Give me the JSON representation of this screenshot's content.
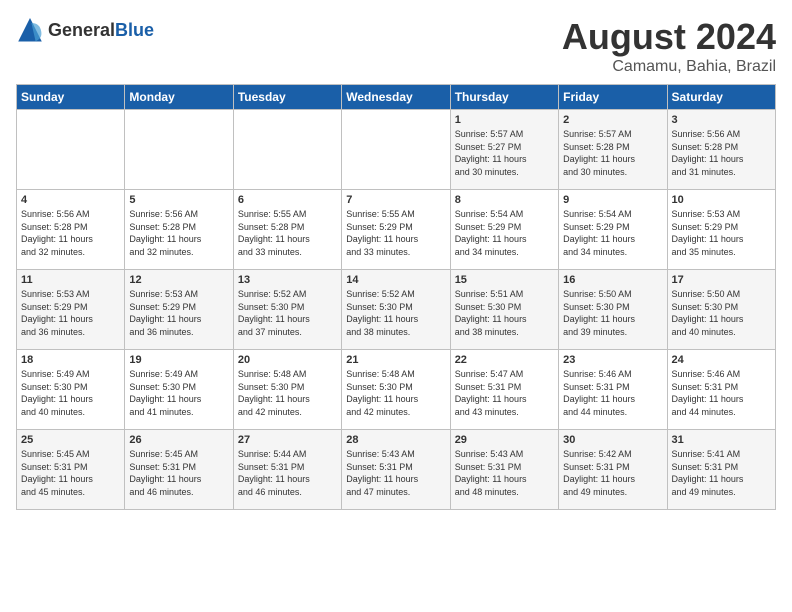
{
  "logo": {
    "general": "General",
    "blue": "Blue"
  },
  "title": "August 2024",
  "subtitle": "Camamu, Bahia, Brazil",
  "headers": [
    "Sunday",
    "Monday",
    "Tuesday",
    "Wednesday",
    "Thursday",
    "Friday",
    "Saturday"
  ],
  "weeks": [
    [
      {
        "day": "",
        "info": ""
      },
      {
        "day": "",
        "info": ""
      },
      {
        "day": "",
        "info": ""
      },
      {
        "day": "",
        "info": ""
      },
      {
        "day": "1",
        "info": "Sunrise: 5:57 AM\nSunset: 5:27 PM\nDaylight: 11 hours\nand 30 minutes."
      },
      {
        "day": "2",
        "info": "Sunrise: 5:57 AM\nSunset: 5:28 PM\nDaylight: 11 hours\nand 30 minutes."
      },
      {
        "day": "3",
        "info": "Sunrise: 5:56 AM\nSunset: 5:28 PM\nDaylight: 11 hours\nand 31 minutes."
      }
    ],
    [
      {
        "day": "4",
        "info": "Sunrise: 5:56 AM\nSunset: 5:28 PM\nDaylight: 11 hours\nand 32 minutes."
      },
      {
        "day": "5",
        "info": "Sunrise: 5:56 AM\nSunset: 5:28 PM\nDaylight: 11 hours\nand 32 minutes."
      },
      {
        "day": "6",
        "info": "Sunrise: 5:55 AM\nSunset: 5:28 PM\nDaylight: 11 hours\nand 33 minutes."
      },
      {
        "day": "7",
        "info": "Sunrise: 5:55 AM\nSunset: 5:29 PM\nDaylight: 11 hours\nand 33 minutes."
      },
      {
        "day": "8",
        "info": "Sunrise: 5:54 AM\nSunset: 5:29 PM\nDaylight: 11 hours\nand 34 minutes."
      },
      {
        "day": "9",
        "info": "Sunrise: 5:54 AM\nSunset: 5:29 PM\nDaylight: 11 hours\nand 34 minutes."
      },
      {
        "day": "10",
        "info": "Sunrise: 5:53 AM\nSunset: 5:29 PM\nDaylight: 11 hours\nand 35 minutes."
      }
    ],
    [
      {
        "day": "11",
        "info": "Sunrise: 5:53 AM\nSunset: 5:29 PM\nDaylight: 11 hours\nand 36 minutes."
      },
      {
        "day": "12",
        "info": "Sunrise: 5:53 AM\nSunset: 5:29 PM\nDaylight: 11 hours\nand 36 minutes."
      },
      {
        "day": "13",
        "info": "Sunrise: 5:52 AM\nSunset: 5:30 PM\nDaylight: 11 hours\nand 37 minutes."
      },
      {
        "day": "14",
        "info": "Sunrise: 5:52 AM\nSunset: 5:30 PM\nDaylight: 11 hours\nand 38 minutes."
      },
      {
        "day": "15",
        "info": "Sunrise: 5:51 AM\nSunset: 5:30 PM\nDaylight: 11 hours\nand 38 minutes."
      },
      {
        "day": "16",
        "info": "Sunrise: 5:50 AM\nSunset: 5:30 PM\nDaylight: 11 hours\nand 39 minutes."
      },
      {
        "day": "17",
        "info": "Sunrise: 5:50 AM\nSunset: 5:30 PM\nDaylight: 11 hours\nand 40 minutes."
      }
    ],
    [
      {
        "day": "18",
        "info": "Sunrise: 5:49 AM\nSunset: 5:30 PM\nDaylight: 11 hours\nand 40 minutes."
      },
      {
        "day": "19",
        "info": "Sunrise: 5:49 AM\nSunset: 5:30 PM\nDaylight: 11 hours\nand 41 minutes."
      },
      {
        "day": "20",
        "info": "Sunrise: 5:48 AM\nSunset: 5:30 PM\nDaylight: 11 hours\nand 42 minutes."
      },
      {
        "day": "21",
        "info": "Sunrise: 5:48 AM\nSunset: 5:30 PM\nDaylight: 11 hours\nand 42 minutes."
      },
      {
        "day": "22",
        "info": "Sunrise: 5:47 AM\nSunset: 5:31 PM\nDaylight: 11 hours\nand 43 minutes."
      },
      {
        "day": "23",
        "info": "Sunrise: 5:46 AM\nSunset: 5:31 PM\nDaylight: 11 hours\nand 44 minutes."
      },
      {
        "day": "24",
        "info": "Sunrise: 5:46 AM\nSunset: 5:31 PM\nDaylight: 11 hours\nand 44 minutes."
      }
    ],
    [
      {
        "day": "25",
        "info": "Sunrise: 5:45 AM\nSunset: 5:31 PM\nDaylight: 11 hours\nand 45 minutes."
      },
      {
        "day": "26",
        "info": "Sunrise: 5:45 AM\nSunset: 5:31 PM\nDaylight: 11 hours\nand 46 minutes."
      },
      {
        "day": "27",
        "info": "Sunrise: 5:44 AM\nSunset: 5:31 PM\nDaylight: 11 hours\nand 46 minutes."
      },
      {
        "day": "28",
        "info": "Sunrise: 5:43 AM\nSunset: 5:31 PM\nDaylight: 11 hours\nand 47 minutes."
      },
      {
        "day": "29",
        "info": "Sunrise: 5:43 AM\nSunset: 5:31 PM\nDaylight: 11 hours\nand 48 minutes."
      },
      {
        "day": "30",
        "info": "Sunrise: 5:42 AM\nSunset: 5:31 PM\nDaylight: 11 hours\nand 49 minutes."
      },
      {
        "day": "31",
        "info": "Sunrise: 5:41 AM\nSunset: 5:31 PM\nDaylight: 11 hours\nand 49 minutes."
      }
    ]
  ]
}
